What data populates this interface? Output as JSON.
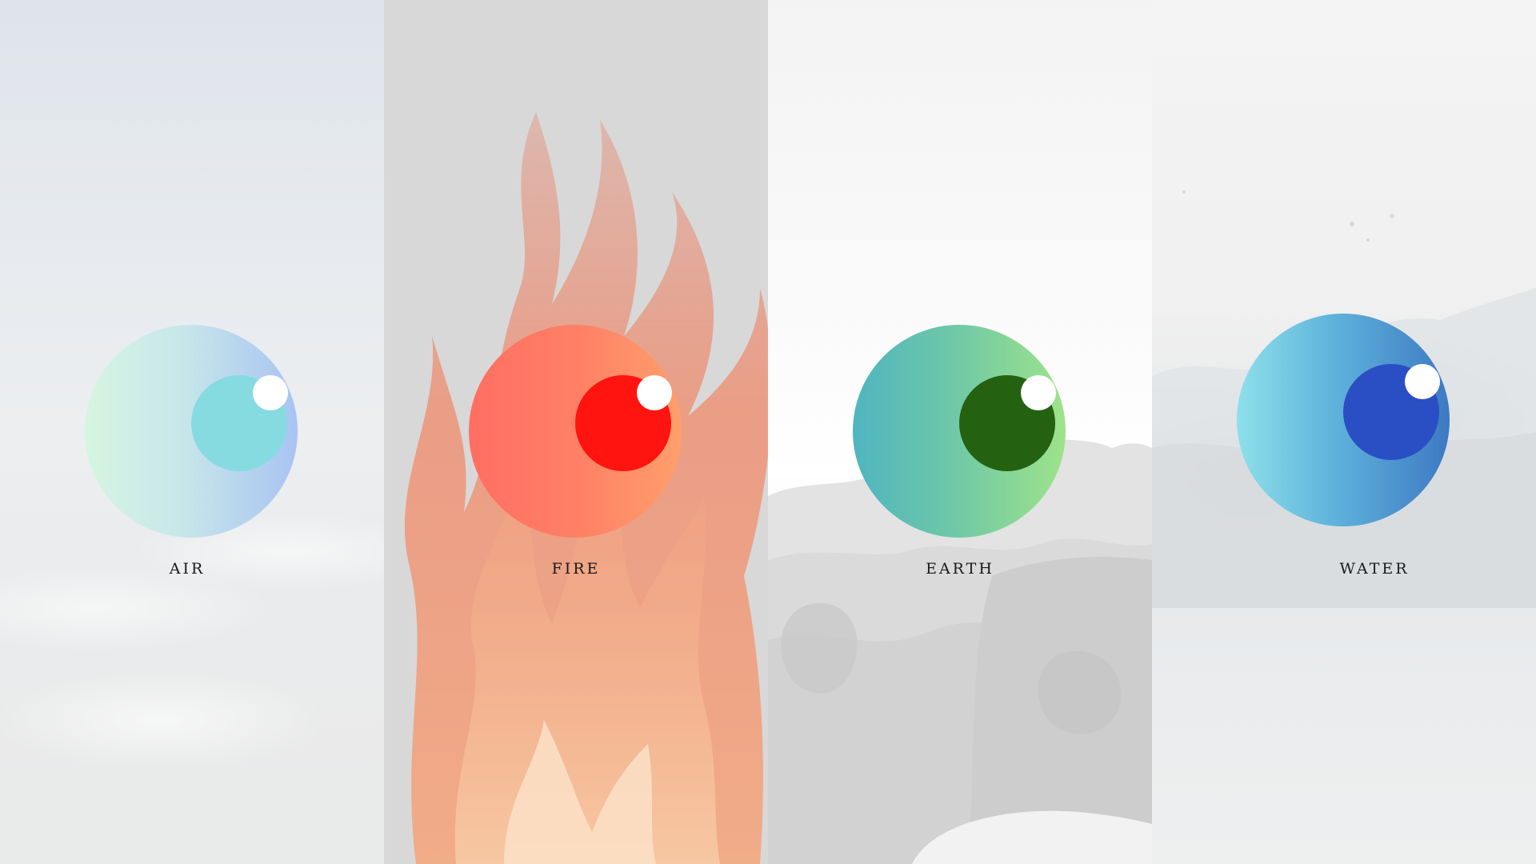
{
  "elements": [
    {
      "id": "air",
      "label": "AIR",
      "icon": "eye-icon",
      "colors": {
        "sclera_from": "#d6f5e2",
        "sclera_to": "#a9c3f2",
        "iris": "#86dbe1",
        "glint": "#ffffff",
        "background": "#e7ebef"
      }
    },
    {
      "id": "fire",
      "label": "FIRE",
      "icon": "eye-icon",
      "colors": {
        "sclera_from": "#ff6f62",
        "sclera_to": "#ff9f6a",
        "iris": "#ff1410",
        "glint": "#ffffff",
        "background": "#d8d8d8"
      }
    },
    {
      "id": "earth",
      "label": "EARTH",
      "icon": "eye-icon",
      "colors": {
        "sclera_from": "#4fb5c0",
        "sclera_to": "#9ee38a",
        "iris": "#246111",
        "glint": "#ffffff",
        "background": "#f7f7f7"
      }
    },
    {
      "id": "water",
      "label": "WATER",
      "icon": "eye-icon",
      "colors": {
        "sclera_from": "#8ee0ea",
        "sclera_to": "#3e79c2",
        "iris": "#2a4fc4",
        "glint": "#ffffff",
        "background": "#eceeef"
      }
    }
  ]
}
